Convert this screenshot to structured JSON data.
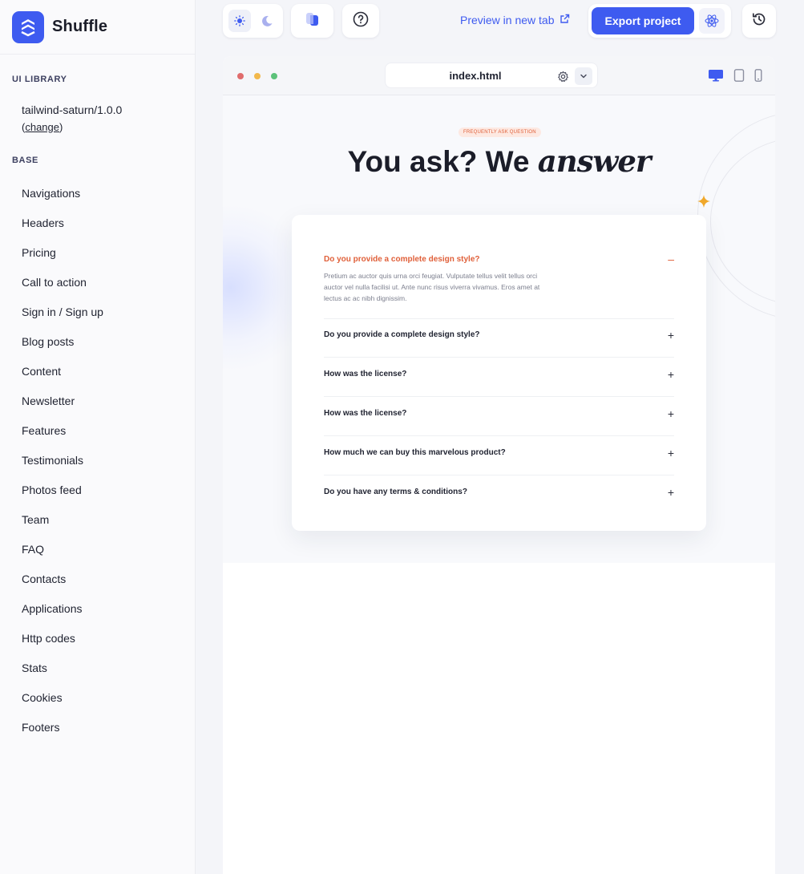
{
  "brand": {
    "name": "Shuffle"
  },
  "sidebar": {
    "library_title": "UI LIBRARY",
    "library_name": "tailwind-saturn/1.0.0",
    "library_change_prefix": "(",
    "library_change_link": "change",
    "library_change_suffix": ")",
    "base_title": "BASE",
    "items": [
      "Navigations",
      "Headers",
      "Pricing",
      "Call to action",
      "Sign in / Sign up",
      "Blog posts",
      "Content",
      "Newsletter",
      "Features",
      "Testimonials",
      "Photos feed",
      "Team",
      "FAQ",
      "Contacts",
      "Applications",
      "Http codes",
      "Stats",
      "Cookies",
      "Footers"
    ]
  },
  "toolbar": {
    "preview_label": "Preview in new tab",
    "export_label": "Export project",
    "icons": [
      "sun-icon",
      "moon-icon",
      "layers-icon",
      "help-icon",
      "external-link-icon",
      "react-icon",
      "history-icon"
    ]
  },
  "preview": {
    "file_name": "index.html",
    "window_dots": [
      "#e06c6c",
      "#f2b84b",
      "#5cc27a"
    ],
    "devices": [
      "desktop-icon",
      "tablet-icon",
      "mobile-icon"
    ],
    "badge": "FREQUENTLY ASK QUESTION",
    "headline_plain": "You ask? We",
    "headline_italic": "answer",
    "faq": [
      {
        "question": "Do you provide a complete design style?",
        "answer": "Pretium ac auctor quis urna orci feugiat. Vulputate tellus velit tellus orci auctor vel nulla facilisi ut. Ante nunc risus viverra vivamus. Eros amet at lectus ac ac nibh dignissim.",
        "toggle": "–",
        "open": true
      },
      {
        "question": "Do you provide a complete design style?",
        "toggle": "+"
      },
      {
        "question": "How was the license?",
        "toggle": "+"
      },
      {
        "question": "How was the license?",
        "toggle": "+"
      },
      {
        "question": "How much we can buy this marvelous product?",
        "toggle": "+"
      },
      {
        "question": "Do you have any terms & conditions?",
        "toggle": "+"
      }
    ]
  },
  "colors": {
    "accent": "#3e5bf0",
    "faq_accent": "#e0603a",
    "sparkle": "#f0a82a"
  }
}
